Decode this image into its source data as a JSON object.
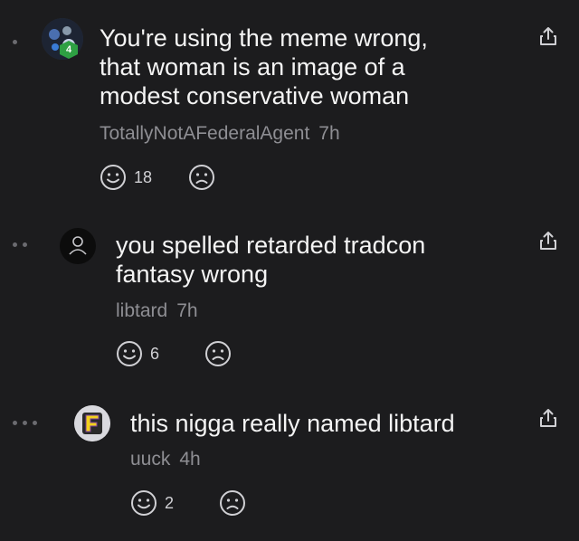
{
  "comments": [
    {
      "depth": 1,
      "lines": [
        "You're using the meme wrong,",
        "that woman is an image of a",
        "modest conservative woman"
      ],
      "author": "TotallyNotAFederalAgent",
      "time": "7h",
      "likes": "18",
      "badge": "4"
    },
    {
      "depth": 2,
      "lines": [
        "you spelled retarded tradcon",
        "fantasy wrong"
      ],
      "author": "libtard",
      "time": "7h",
      "likes": "6"
    },
    {
      "depth": 3,
      "lines": [
        "this nigga really named libtard"
      ],
      "author": "uuck",
      "time": "4h",
      "likes": "2"
    }
  ],
  "icons": {
    "smile": "smile-icon",
    "frown": "frown-icon",
    "share": "share-icon",
    "user": "user-icon"
  },
  "colors": {
    "background": "#1c1c1e",
    "text": "#f4f4f4",
    "muted": "#8e8e93",
    "badge": "#2ea043"
  }
}
